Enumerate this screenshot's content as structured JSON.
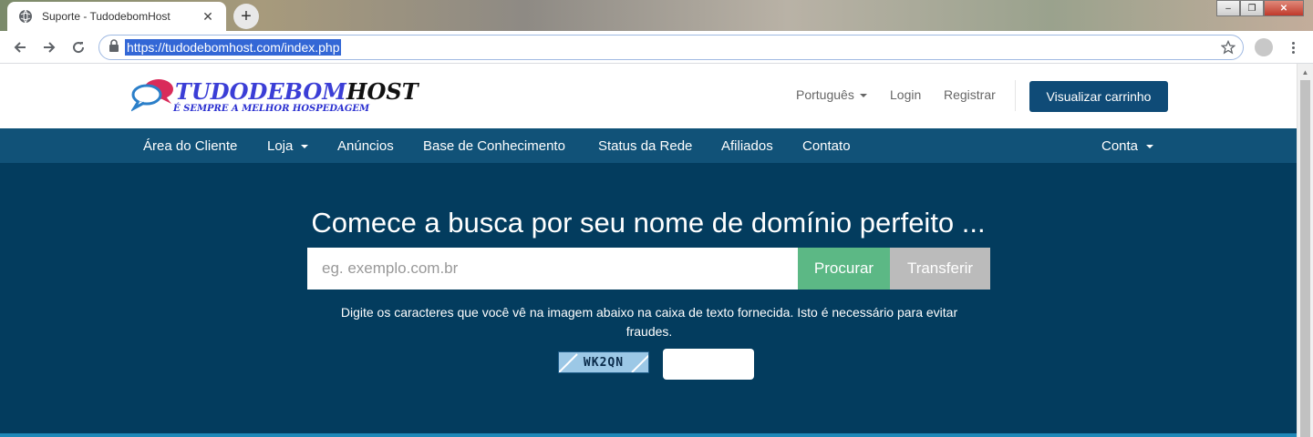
{
  "browser": {
    "tab_title": "Suporte - TudodebomHost",
    "tab_close": "✕",
    "new_tab": "+",
    "url": "https://tudodebomhost.com/index.php",
    "window_controls": {
      "minimize": "–",
      "maximize": "❐",
      "close": "✕"
    }
  },
  "site": {
    "logo_main_a": "TUDODEBOM",
    "logo_main_b": "HOST",
    "logo_sub": "É SEMPRE A MELHOR HOSPEDAGEM",
    "top_nav": {
      "language": "Português",
      "login": "Login",
      "register": "Registrar",
      "cart": "Visualizar carrinho"
    },
    "main_nav": {
      "client_area": "Área do Cliente",
      "shop": "Loja",
      "announcements": "Anúncios",
      "knowledgebase": "Base de Conhecimento",
      "network_status": "Status da Rede",
      "affiliates": "Afiliados",
      "contact": "Contato",
      "account": "Conta"
    },
    "hero": {
      "title": "Comece a busca por seu nome de domínio perfeito ...",
      "search_placeholder": "eg. exemplo.com.br",
      "search_button": "Procurar",
      "transfer_button": "Transferir",
      "captcha_note": "Digite os caracteres que você vê na imagem abaixo na caixa de texto fornecida. Isto é necessário para evitar fraudes.",
      "captcha_text": "WK2QN"
    }
  },
  "colors": {
    "nav_bar": "#115278",
    "hero_bg": "#033c5e",
    "cart_button": "#0f4b77",
    "search_button": "#5cb885",
    "transfer_button": "#bbbbbb"
  }
}
